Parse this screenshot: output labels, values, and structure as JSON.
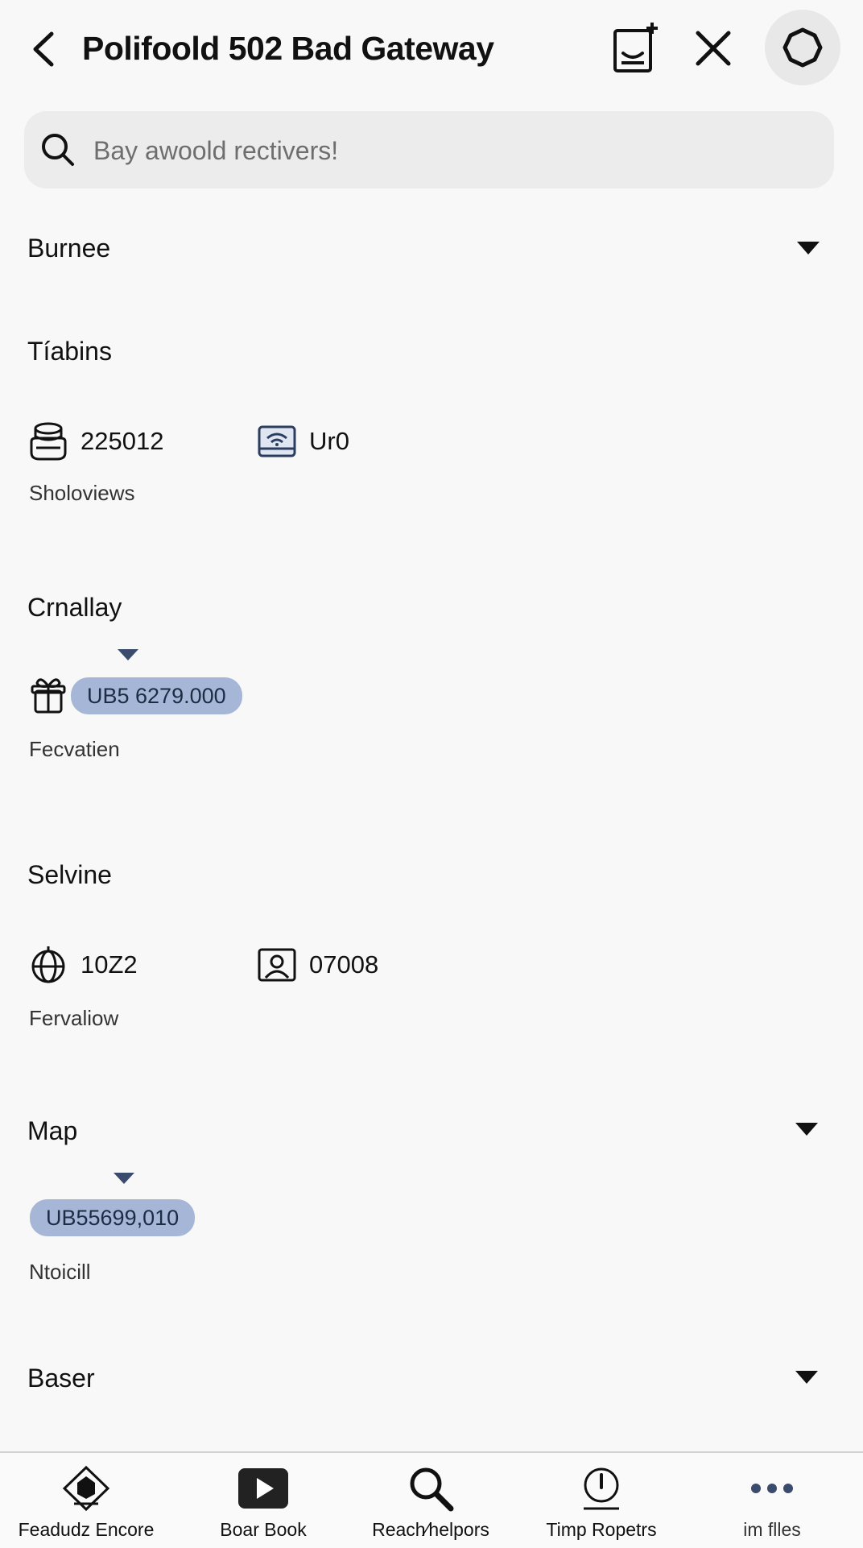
{
  "header": {
    "title": "Polifoold 502 Bad Gateway",
    "back_icon": "chevron-left-icon",
    "new_doc_icon": "add-document-icon",
    "close_icon": "close-icon",
    "settings_icon": "settings-icon"
  },
  "search": {
    "placeholder": "Bay awoold rectivers!",
    "icon": "search-icon"
  },
  "sections": {
    "burnee": {
      "title": "Burnee"
    },
    "tabins": {
      "title": "Tíabins",
      "stat1": {
        "value": "225012",
        "icon": "storage-icon"
      },
      "stat2": {
        "value": "Ur0",
        "icon": "wifi-card-icon"
      },
      "caption": "Sholoviews"
    },
    "crnallay": {
      "title": "Crnallay",
      "pill": "UB5 6279.000",
      "icon": "gift-icon",
      "caption": "Fecvatien"
    },
    "selvine": {
      "title": "Selvine",
      "stat1": {
        "value": "10Z2",
        "icon": "globe-icon"
      },
      "stat2": {
        "value": "07008",
        "icon": "profile-card-icon"
      },
      "caption": "Fervaliow"
    },
    "map": {
      "title": "Map",
      "pill": "UB55699,010",
      "caption": "Ntoicill"
    },
    "baser": {
      "title": "Baser"
    }
  },
  "bottom_nav": [
    {
      "label": "Feadudz Encore",
      "icon": "home-diamond-icon"
    },
    {
      "label": "Boar Book",
      "icon": "play-icon"
    },
    {
      "label": "Reach⁄helpors",
      "icon": "search-icon"
    },
    {
      "label": "Timp Ropetrs",
      "icon": "clock-icon"
    },
    {
      "label": "im flles",
      "icon": "more-dots-icon"
    }
  ],
  "colors": {
    "background": "#f7f8f7",
    "pill": "#a5b6d6",
    "accent_dark": "#3b4b6e"
  }
}
